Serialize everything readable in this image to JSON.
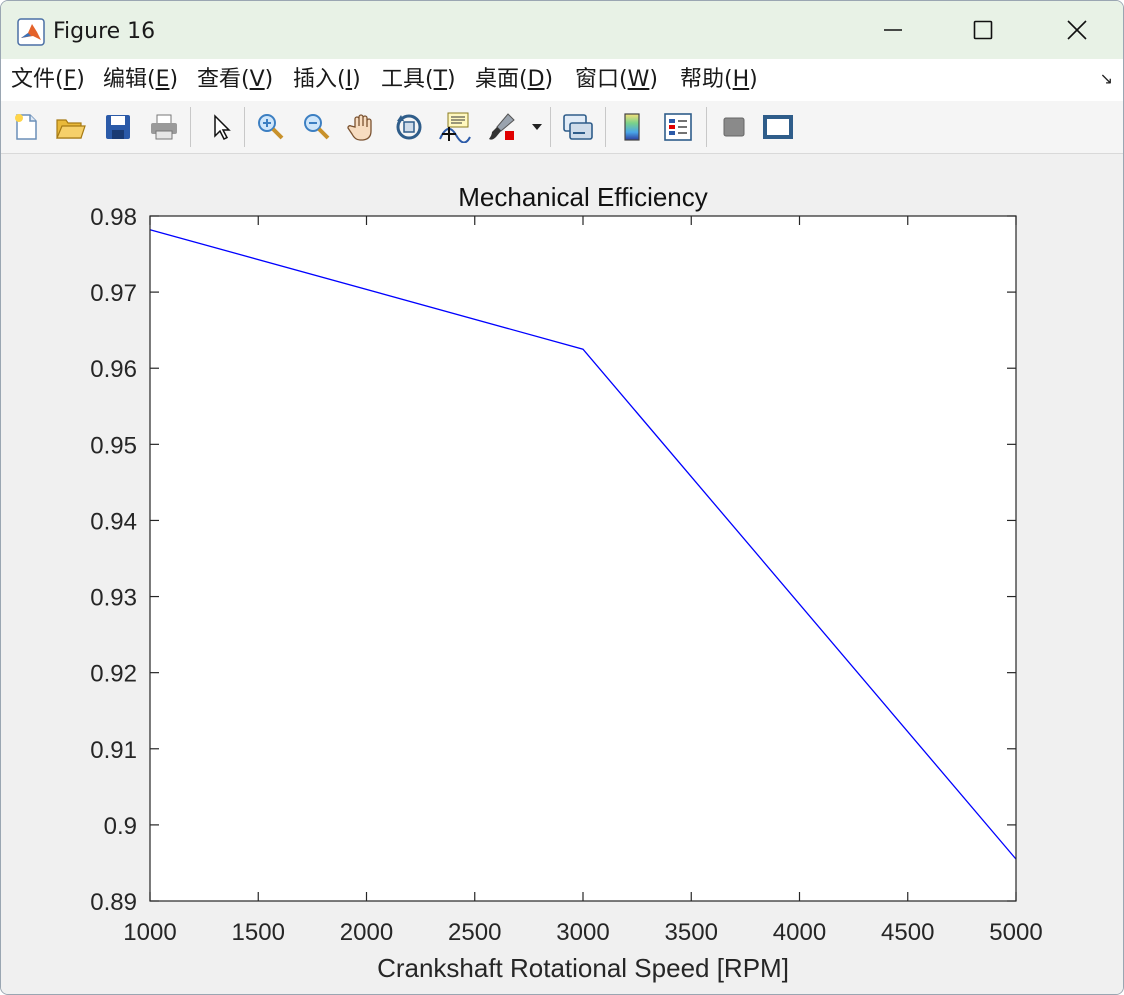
{
  "window": {
    "title": "Figure 16"
  },
  "menu": {
    "items": [
      {
        "label": "文件(",
        "key": "F",
        "end": ")"
      },
      {
        "label": "编辑(",
        "key": "E",
        "end": ")"
      },
      {
        "label": "查看(",
        "key": "V",
        "end": ")"
      },
      {
        "label": "插入(",
        "key": "I",
        "end": ")"
      },
      {
        "label": "工具(",
        "key": "T",
        "end": ")"
      },
      {
        "label": "桌面(",
        "key": "D",
        "end": ")"
      },
      {
        "label": "窗口(",
        "key": "W",
        "end": ")"
      },
      {
        "label": "帮助(",
        "key": "H",
        "end": ")"
      }
    ]
  },
  "toolbar": {
    "icons": [
      "new-figure-icon",
      "open-file-icon",
      "save-icon",
      "print-icon",
      "pointer-icon",
      "zoom-in-icon",
      "zoom-out-icon",
      "pan-hand-icon",
      "rotate-3d-icon",
      "data-cursor-icon",
      "brush-icon",
      "brush-dropdown-icon",
      "link-plot-icon",
      "colorbar-icon",
      "legend-icon",
      "hide-plot-tools-icon",
      "show-plot-tools-icon"
    ]
  },
  "colors": {
    "line": "#0000ff",
    "axes_bg": "#ffffff",
    "figure_bg": "#f0f0f0",
    "titlebar_bg": "#e8f2e6"
  },
  "chart_data": {
    "type": "line",
    "title": "Mechanical Efficiency",
    "xlabel": "Crankshaft Rotational Speed [RPM]",
    "ylabel": "",
    "xlim": [
      1000,
      5000
    ],
    "ylim": [
      0.89,
      0.98
    ],
    "xticks": [
      1000,
      1500,
      2000,
      2500,
      3000,
      3500,
      4000,
      4500,
      5000
    ],
    "xtick_labels": [
      "1000",
      "1500",
      "2000",
      "2500",
      "3000",
      "3500",
      "4000",
      "4500",
      "5000"
    ],
    "yticks": [
      0.89,
      0.9,
      0.91,
      0.92,
      0.93,
      0.94,
      0.95,
      0.96,
      0.97,
      0.98
    ],
    "ytick_labels": [
      "0.89",
      "0.9",
      "0.91",
      "0.92",
      "0.93",
      "0.94",
      "0.95",
      "0.96",
      "0.97",
      "0.98"
    ],
    "grid": false,
    "series": [
      {
        "x": [
          1000,
          3000,
          5000
        ],
        "y": [
          0.9782,
          0.9625,
          0.8955
        ]
      }
    ]
  }
}
